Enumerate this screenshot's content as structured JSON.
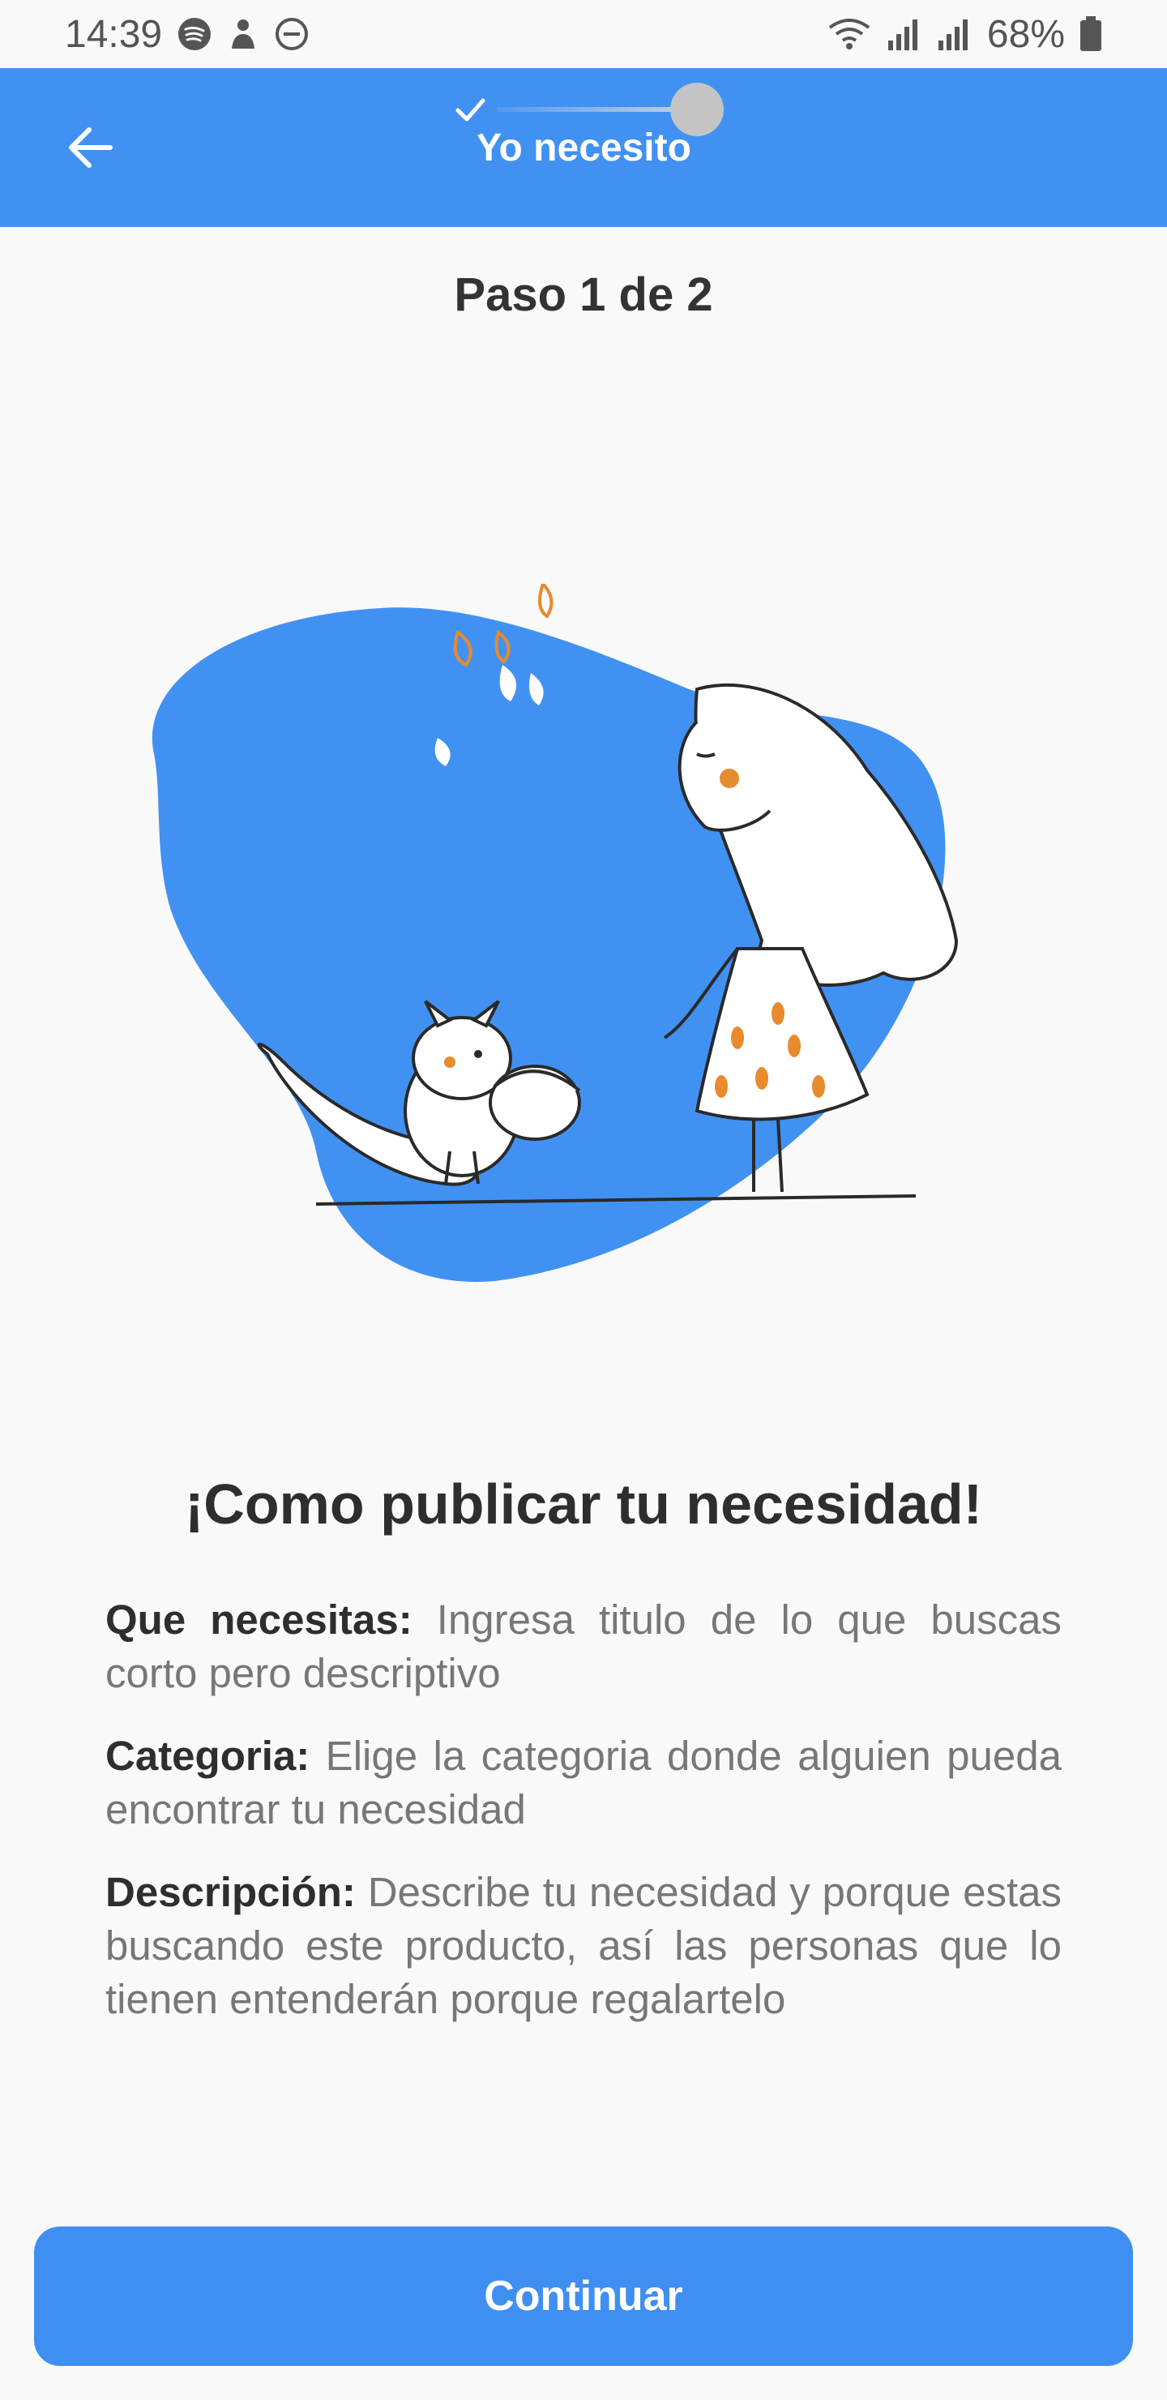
{
  "status_bar": {
    "time": "14:39",
    "battery": "68%",
    "left_icons": [
      "spotify-icon",
      "person-icon",
      "do-not-disturb-icon"
    ],
    "right_icons": [
      "wifi-icon",
      "signal-icon",
      "signal-icon",
      "battery-icon"
    ]
  },
  "app_bar": {
    "title": "Yo necesito",
    "back_icon": "arrow-left-icon",
    "color": "#4191f2"
  },
  "stepper": {
    "title": "Paso 1 de 2",
    "current_step": 1,
    "total_steps": 2,
    "done_color": "#4191f2",
    "pending_color": "#c4c4c4"
  },
  "heading": "¡Como publicar tu necesidad!",
  "instructions": [
    {
      "label": "Que necesitas:",
      "text": " Ingresa titulo de lo que buscas corto pero descriptivo"
    },
    {
      "label": "Categoria:",
      "text": " Elige la categoria donde alguien pueda encontrar tu necesidad"
    },
    {
      "label": "Descripción:",
      "text": " Describe tu necesidad y porque estas buscando este producto, así las personas que lo tienen entenderán porque regalartelo"
    }
  ],
  "continue_button": {
    "label": "Continuar",
    "color": "#3f8ff2"
  }
}
